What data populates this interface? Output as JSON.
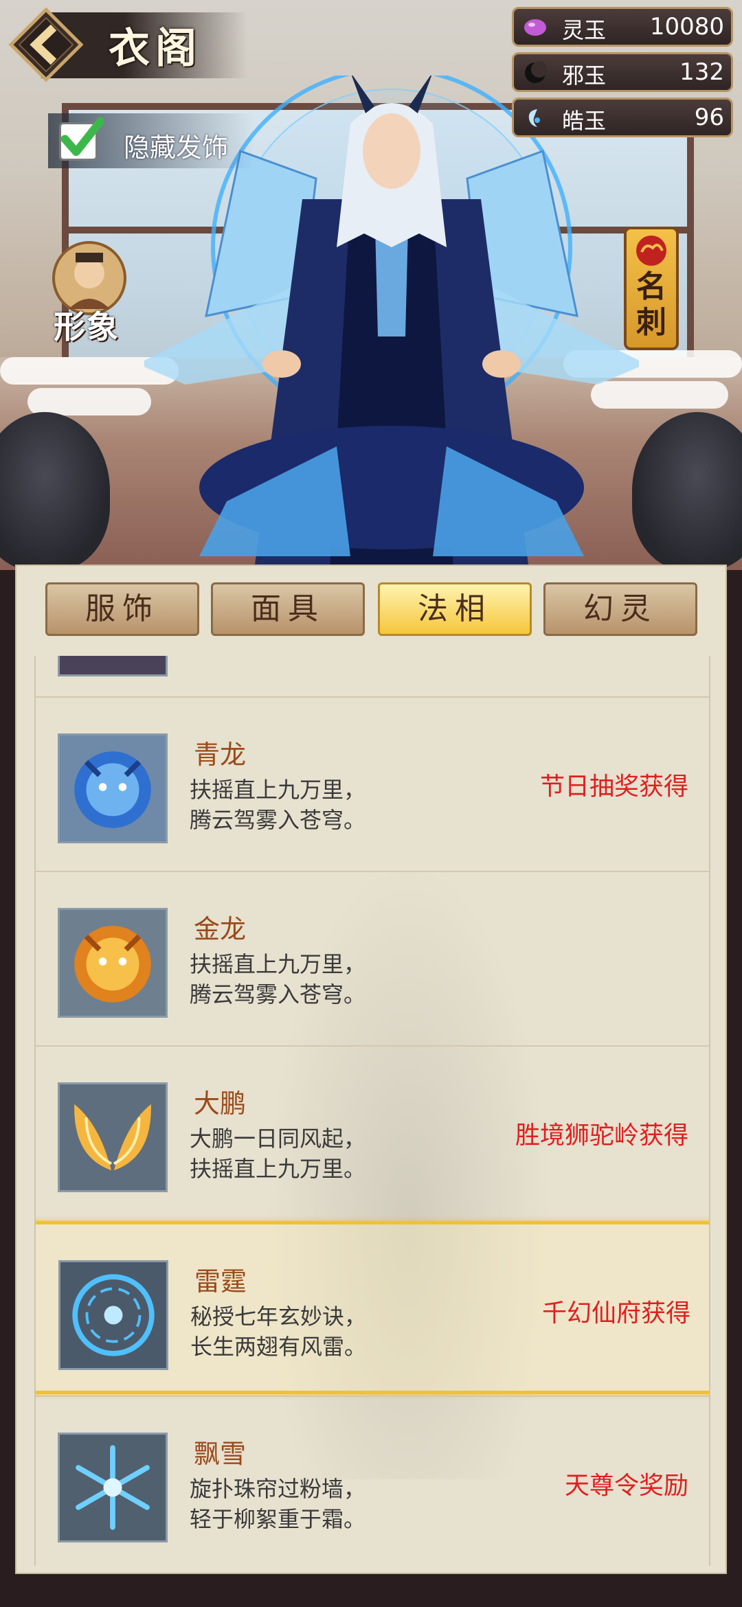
{
  "header": {
    "title": "衣阁",
    "hide_hair_label": "隐藏发饰",
    "image_label": "形象",
    "namecard_label": "名刺"
  },
  "currencies": [
    {
      "name": "灵玉",
      "value": "10080",
      "icon": "orb-icon",
      "color": "#c35bd6"
    },
    {
      "name": "邪玉",
      "value": "132",
      "icon": "crescent-icon",
      "color": "#222222"
    },
    {
      "name": "皓玉",
      "value": "96",
      "icon": "white-jade-icon",
      "color": "#4fb3ff"
    }
  ],
  "tabs": [
    {
      "label": "服饰",
      "active": false
    },
    {
      "label": "面具",
      "active": false
    },
    {
      "label": "法相",
      "active": true
    },
    {
      "label": "幻灵",
      "active": false
    }
  ],
  "items": [
    {
      "name": "青龙",
      "desc": "扶摇直上九万里，\n腾云驾雾入苍穹。",
      "source": "节日抽奖获得",
      "icon": "blue-dragon-icon"
    },
    {
      "name": "金龙",
      "desc": "扶摇直上九万里，\n腾云驾雾入苍穹。",
      "source": "",
      "icon": "golden-dragon-icon"
    },
    {
      "name": "大鹏",
      "desc": "大鹏一日同风起，\n扶摇直上九万里。",
      "source": "胜境狮驼岭获得",
      "icon": "golden-wings-icon"
    },
    {
      "name": "雷霆",
      "desc": "秘授七年玄妙诀，\n长生两翅有风雷。",
      "source": "千幻仙府获得",
      "icon": "thunder-circle-icon",
      "selected": true
    },
    {
      "name": "飘雪",
      "desc": "旋扑珠帘过粉墙，\n轻于柳絮重于霜。",
      "source": "天尊令奖励",
      "icon": "snowflake-icon"
    }
  ],
  "colors": {
    "source_text": "#e01f1f",
    "name_text": "#9a4a1a",
    "selected_border": "#f0c233"
  }
}
